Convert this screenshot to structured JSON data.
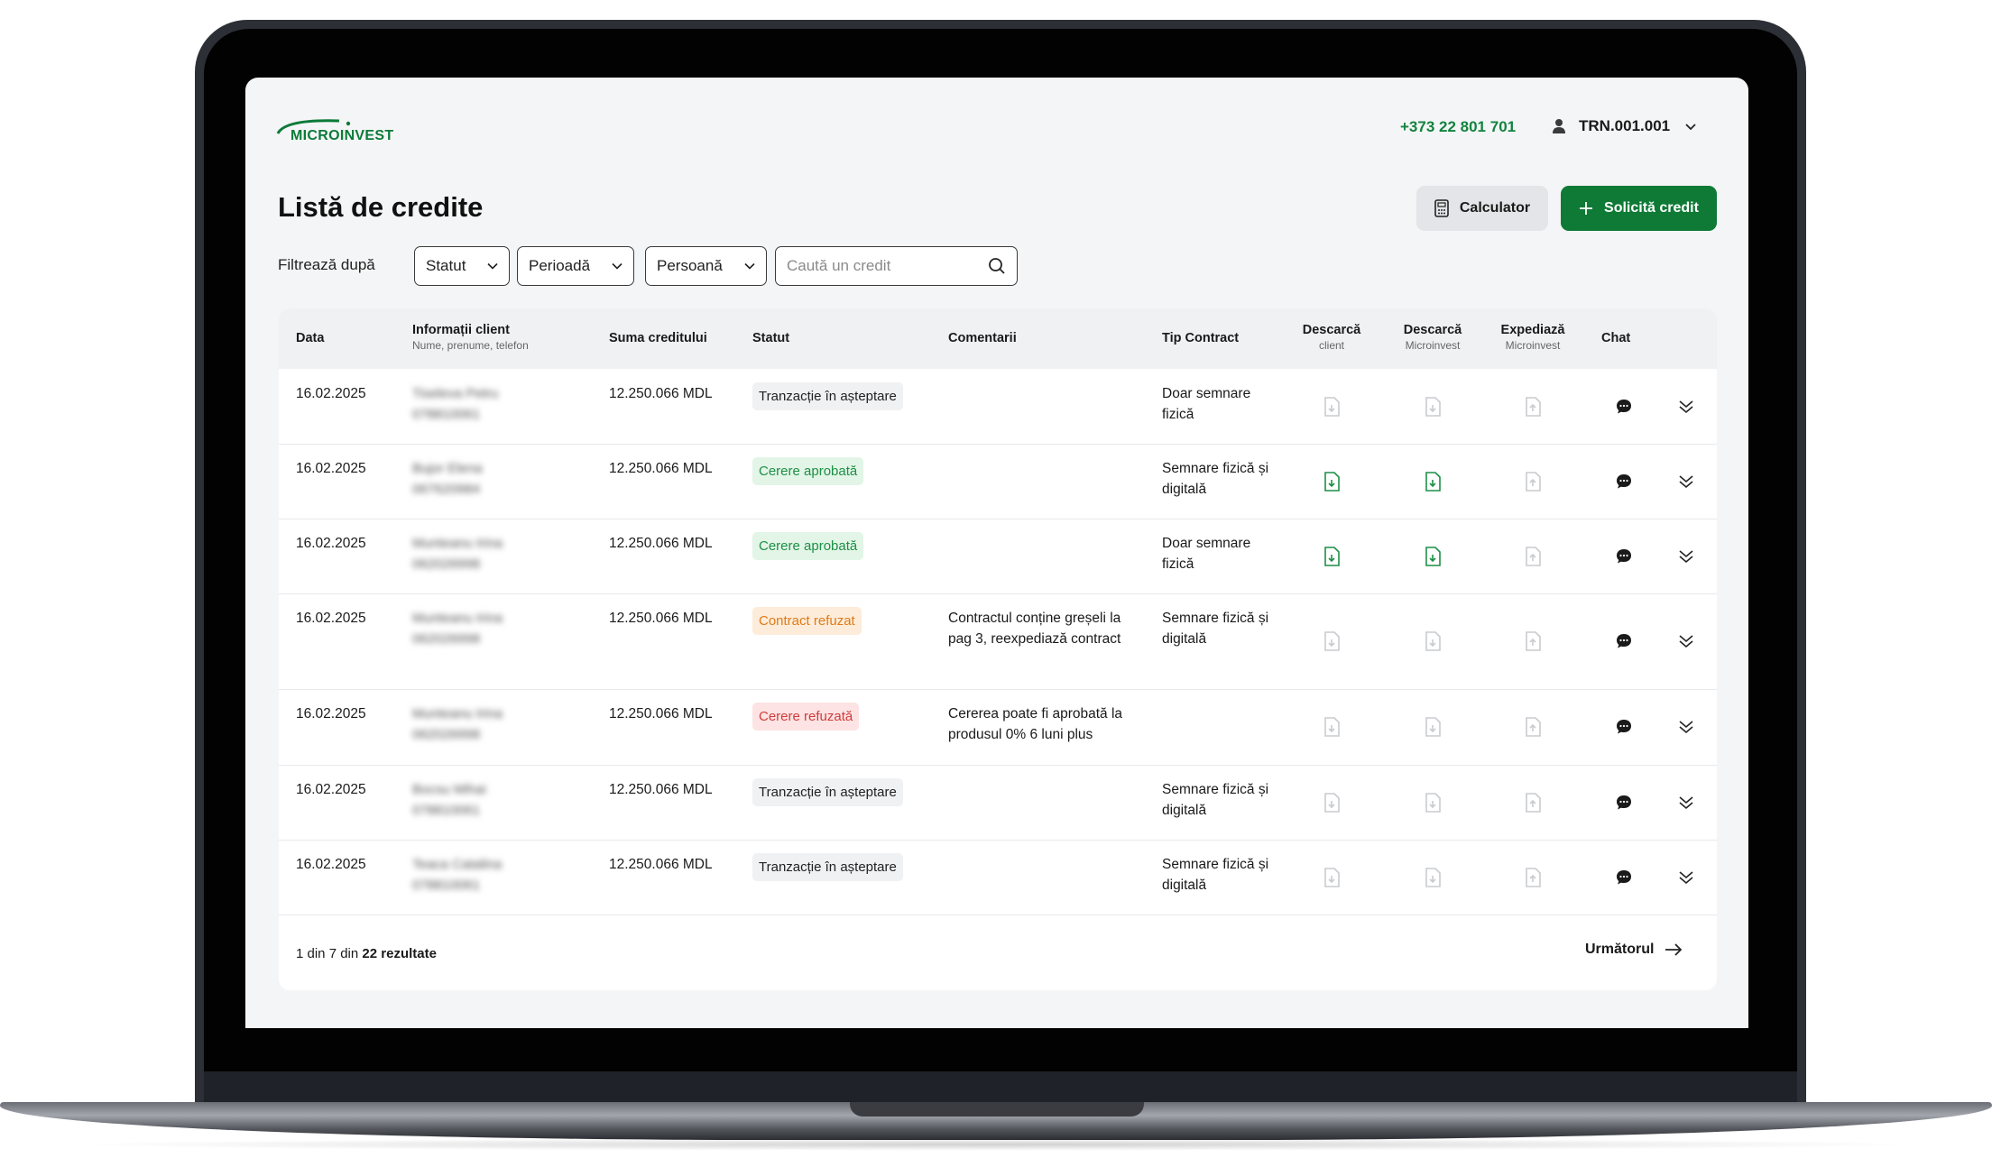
{
  "header": {
    "logo_text": "MICROINVEST",
    "phone": "+373 22 801 701",
    "user_code": "TRN.001.001"
  },
  "page": {
    "title": "Listă de credite",
    "calculator_label": "Calculator",
    "new_credit_label": "Solicită credit"
  },
  "filters": {
    "label": "Filtrează după",
    "status": "Statut",
    "period": "Perioadă",
    "person": "Persoană",
    "search_placeholder": "Caută un credit"
  },
  "table": {
    "columns": {
      "date": "Data",
      "client": "Informații client",
      "client_sub": "Nume, prenume, telefon",
      "amount": "Suma creditului",
      "status": "Statut",
      "comments": "Comentarii",
      "contract_type": "Tip Contract",
      "download_client": "Descarcă",
      "download_client_sub": "client",
      "download_mi": "Descarcă",
      "download_mi_sub": "Microinvest",
      "send": "Expediază",
      "send_sub": "Microinvest",
      "chat": "Chat"
    },
    "rows": [
      {
        "date": "16.02.2025",
        "name": "Tiseleva Petru",
        "phone": "078810061",
        "amount": "12.250.066 MDL",
        "status": "Tranzacție în așteptare",
        "status_kind": "pending",
        "comment": "",
        "contract_type": "Doar semnare fizică",
        "dl_client": "disabled",
        "dl_mi": "disabled"
      },
      {
        "date": "16.02.2025",
        "name": "Bujor Elena",
        "phone": "067620984",
        "amount": "12.250.066 MDL",
        "status": "Cerere aprobată",
        "status_kind": "approved",
        "comment": "",
        "contract_type": "Semnare fizică și digitală",
        "dl_client": "active",
        "dl_mi": "active"
      },
      {
        "date": "16.02.2025",
        "name": "Munteanu Irina",
        "phone": "062026998",
        "amount": "12.250.066 MDL",
        "status": "Cerere aprobată",
        "status_kind": "approved",
        "comment": "",
        "contract_type": "Doar semnare fizică",
        "dl_client": "active",
        "dl_mi": "active"
      },
      {
        "date": "16.02.2025",
        "name": "Munteanu Irina",
        "phone": "062026998",
        "amount": "12.250.066 MDL",
        "status": "Contract refuzat",
        "status_kind": "rejected-contract",
        "comment": "Contractul conține greșeli la pag 3, reexpediază contract",
        "contract_type": "Semnare fizică și digitală",
        "dl_client": "disabled",
        "dl_mi": "disabled"
      },
      {
        "date": "16.02.2025",
        "name": "Munteanu Irina",
        "phone": "062026998",
        "amount": "12.250.066 MDL",
        "status": "Cerere refuzată",
        "status_kind": "rejected",
        "comment": "Cererea poate fi aprobată la produsul 0% 6 luni plus",
        "contract_type": "",
        "dl_client": "disabled",
        "dl_mi": "disabled"
      },
      {
        "date": "16.02.2025",
        "name": "Bocsu Mihai",
        "phone": "078810061",
        "amount": "12.250.066 MDL",
        "status": "Tranzacție în așteptare",
        "status_kind": "pending",
        "comment": "",
        "contract_type": "Semnare fizică și digitală",
        "dl_client": "disabled",
        "dl_mi": "disabled"
      },
      {
        "date": "16.02.2025",
        "name": "Teaca Catalina",
        "phone": "078810061",
        "amount": "12.250.066 MDL",
        "status": "Tranzacție în așteptare",
        "status_kind": "pending",
        "comment": "",
        "contract_type": "Semnare fizică și digitală",
        "dl_client": "disabled",
        "dl_mi": "disabled"
      }
    ]
  },
  "pagination": {
    "prefix": "1 din 7 din",
    "total": "22 rezultate",
    "next_label": "Următorul"
  },
  "colors": {
    "brand_green": "#0e7a36",
    "approved": "#1e8f46",
    "rejected": "#d23b3b",
    "rejected_contract": "#e07a18"
  }
}
